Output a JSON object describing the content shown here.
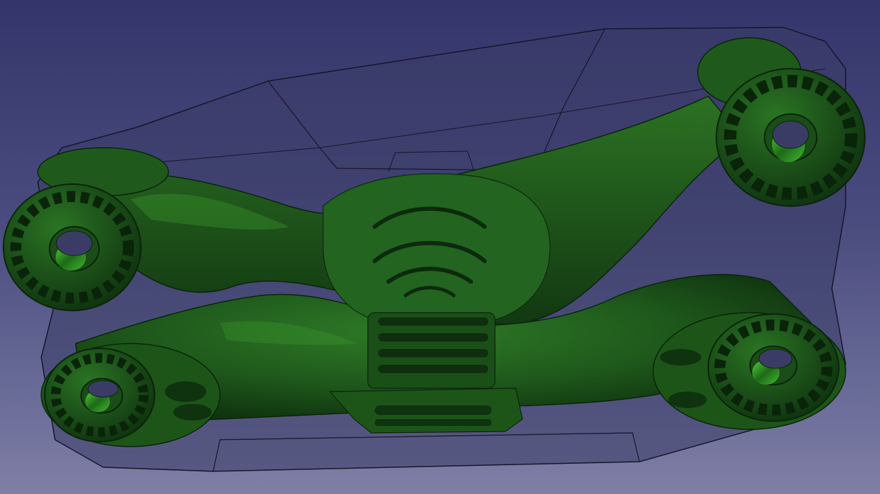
{
  "viewer": {
    "kind": "3D CAD viewport",
    "background_top": "#34356a",
    "background_bottom": "#807fa6"
  },
  "model": {
    "part": "green-ghost-bracket",
    "part_color": "#1f5a1c",
    "part_highlight": "#3fa12f",
    "part_shadow": "#0c2a0c",
    "envelope_color": "#3b3c66",
    "envelope_edge": "#15152a",
    "bosses": [
      {
        "name": "boss-top-right"
      },
      {
        "name": "boss-left"
      },
      {
        "name": "boss-bottom-left"
      },
      {
        "name": "boss-bottom-right"
      }
    ]
  }
}
